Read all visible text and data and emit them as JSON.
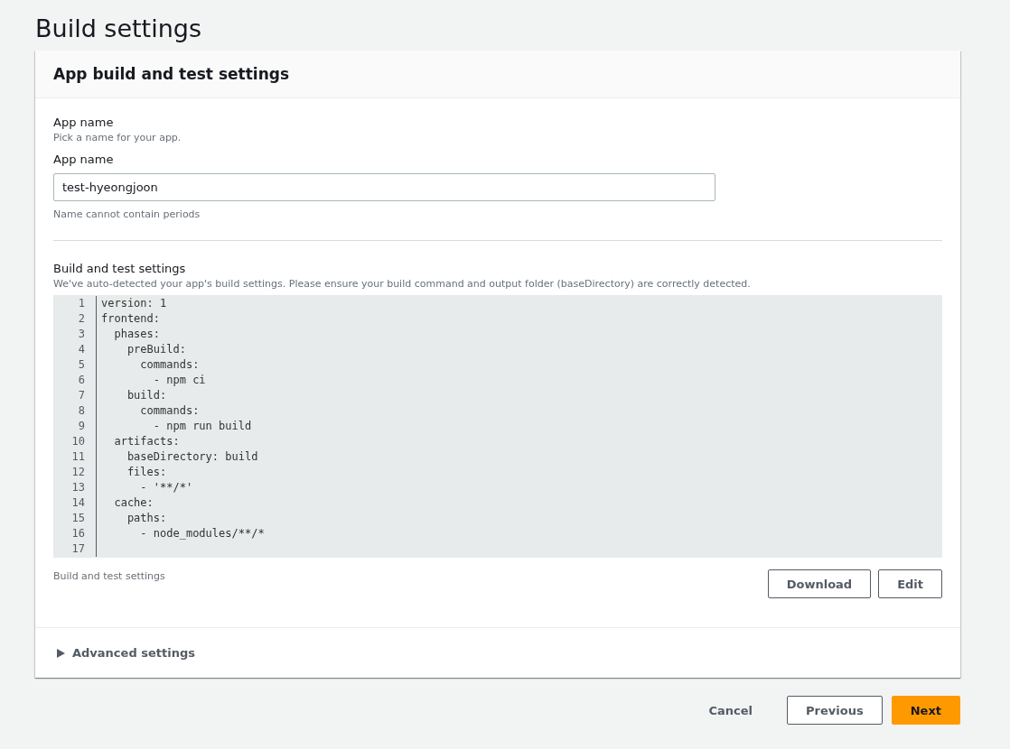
{
  "page_title": "Build settings",
  "card": {
    "title": "App build and test settings",
    "app_name": {
      "heading": "App name",
      "description": "Pick a name for your app.",
      "label": "App name",
      "value": "test-hyeongjoon",
      "constraint": "Name cannot contain periods"
    },
    "build_settings": {
      "heading": "Build and test settings",
      "description": "We've auto-detected your app's build settings. Please ensure your build command and output folder (baseDirectory) are correctly detected.",
      "code_lines": [
        {
          "number": "1",
          "text": "version: 1"
        },
        {
          "number": "2",
          "text": "frontend:"
        },
        {
          "number": "3",
          "text": "  phases:"
        },
        {
          "number": "4",
          "text": "    preBuild:"
        },
        {
          "number": "5",
          "text": "      commands:"
        },
        {
          "number": "6",
          "text": "        - npm ci"
        },
        {
          "number": "7",
          "text": "    build:"
        },
        {
          "number": "8",
          "text": "      commands:"
        },
        {
          "number": "9",
          "text": "        - npm run build"
        },
        {
          "number": "10",
          "text": "  artifacts:"
        },
        {
          "number": "11",
          "text": "    baseDirectory: build"
        },
        {
          "number": "12",
          "text": "    files:"
        },
        {
          "number": "13",
          "text": "      - '**/*'"
        },
        {
          "number": "14",
          "text": "  cache:"
        },
        {
          "number": "15",
          "text": "    paths:"
        },
        {
          "number": "16",
          "text": "      - node_modules/**/*"
        },
        {
          "number": "17"
        }
      ],
      "caption": "Build and test settings",
      "buttons": [
        "Download",
        "Edit"
      ]
    },
    "advanced": {
      "label": "Advanced settings",
      "expanded": false
    }
  },
  "footer": {
    "cancel": "Cancel",
    "previous": "Previous",
    "next": "Next"
  }
}
